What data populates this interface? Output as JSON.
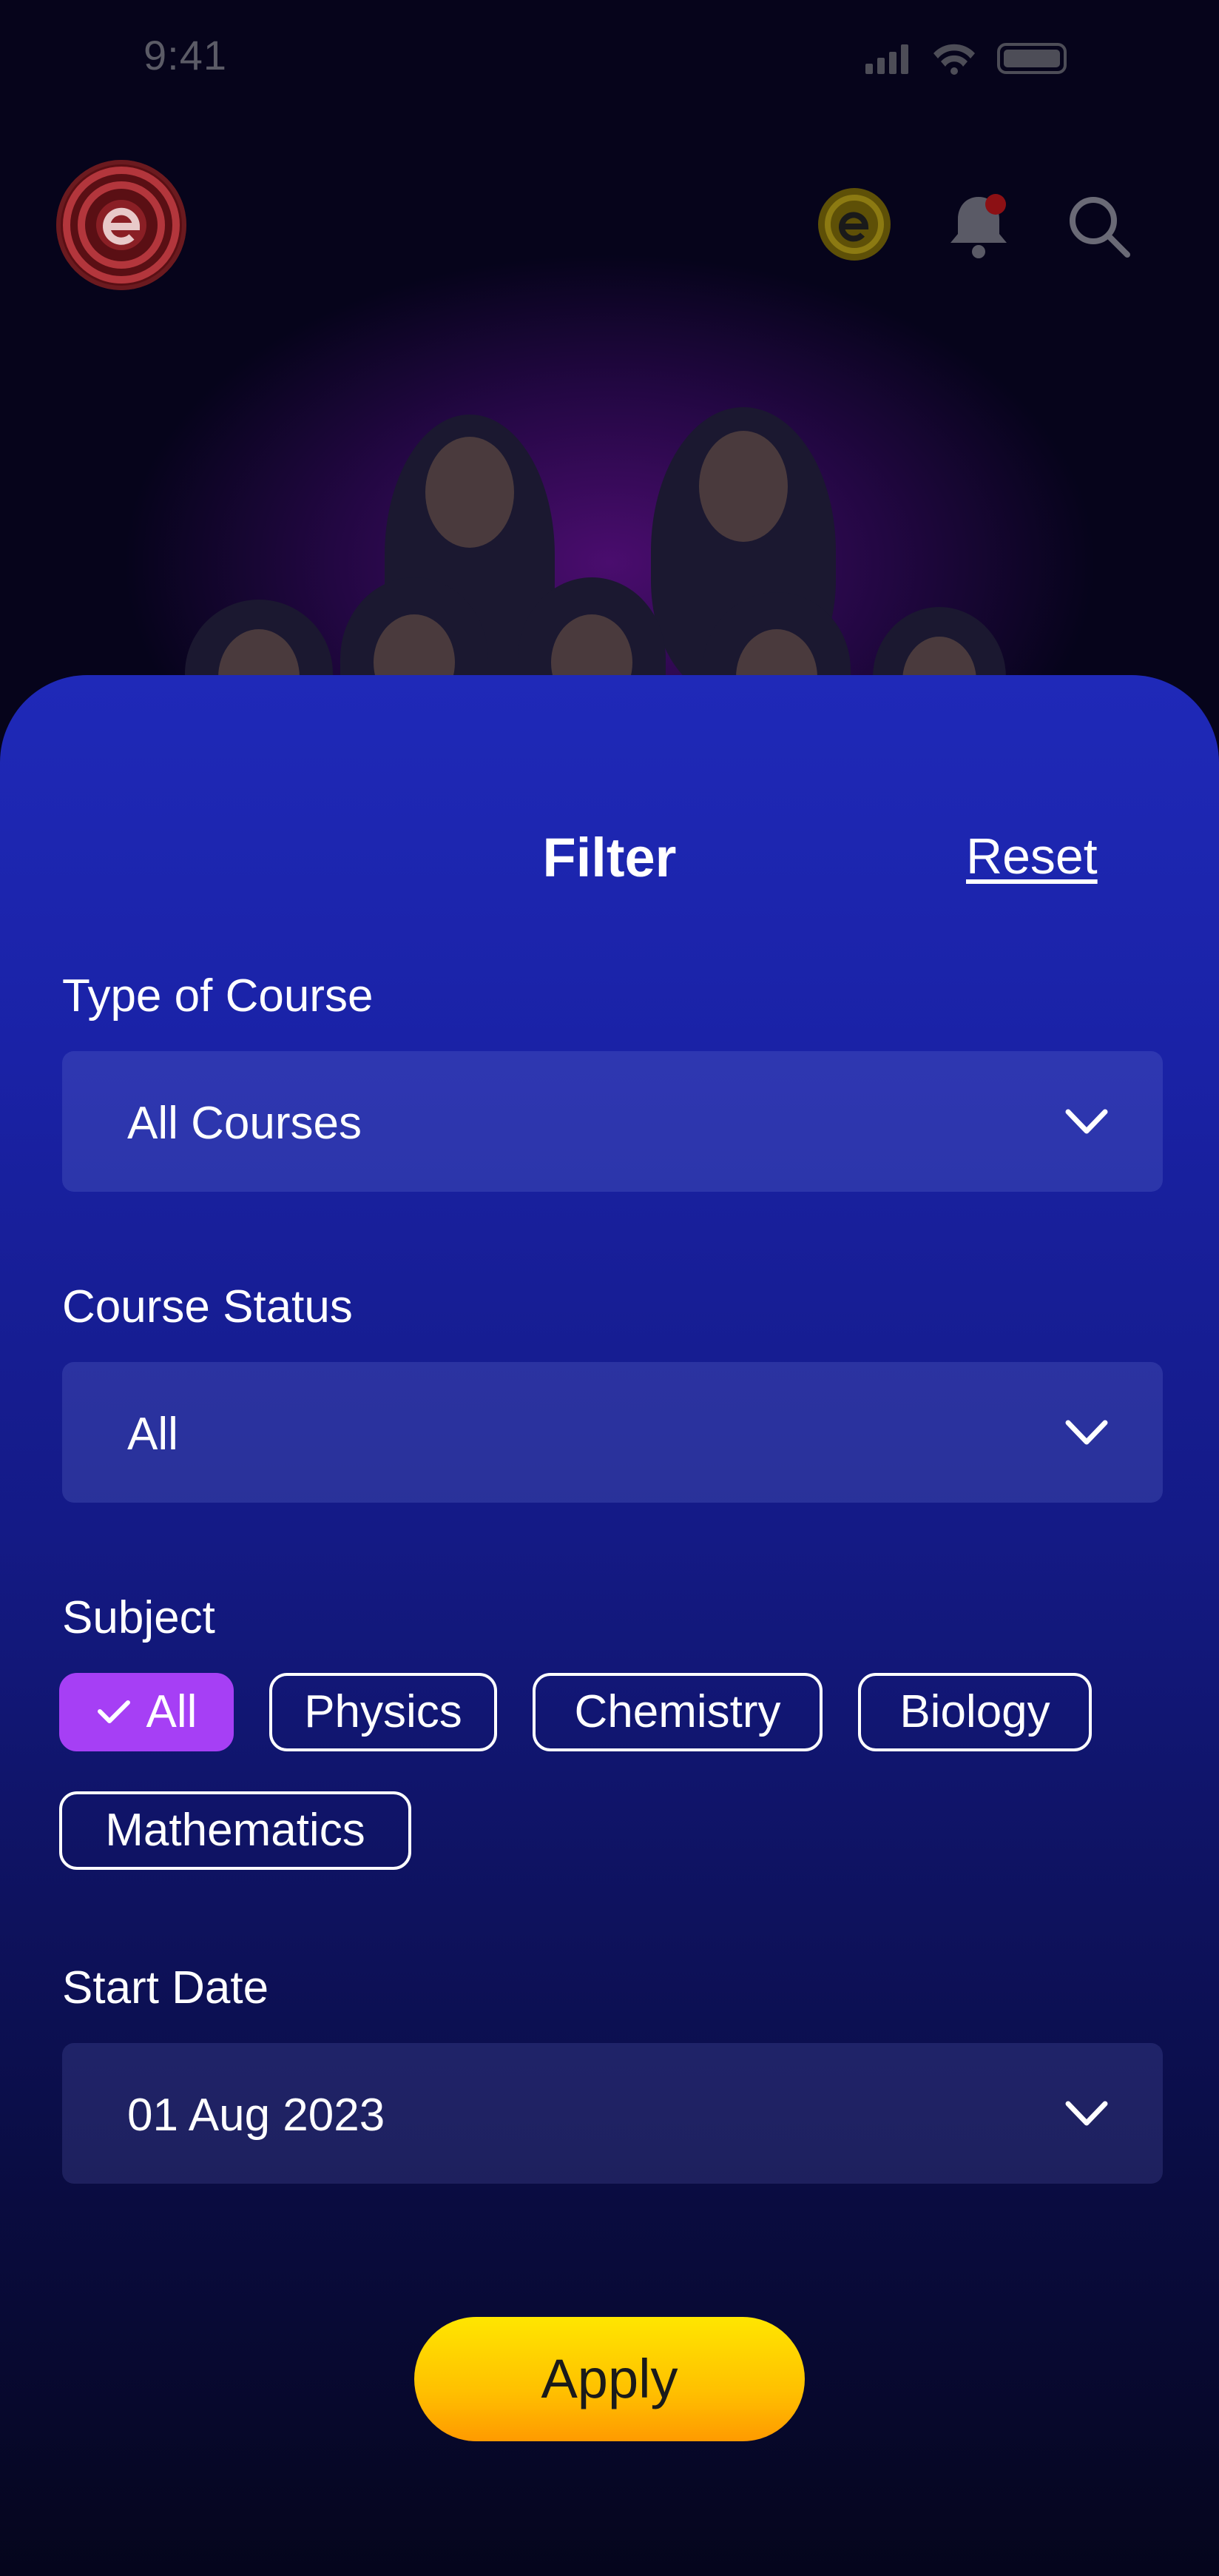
{
  "status_bar": {
    "time": "9:41"
  },
  "header": {
    "logo_icon": "brand-logo-icon",
    "coin_icon": "coin-icon",
    "bell_icon": "bell-icon",
    "search_icon": "search-icon"
  },
  "filter": {
    "title": "Filter",
    "reset_label": "Reset",
    "type_of_course": {
      "label": "Type of Course",
      "value": "All Courses"
    },
    "course_status": {
      "label": "Course Status",
      "value": "All"
    },
    "subject": {
      "label": "Subject",
      "chips": [
        {
          "label": "All",
          "selected": true
        },
        {
          "label": "Physics",
          "selected": false
        },
        {
          "label": "Chemistry",
          "selected": false
        },
        {
          "label": "Biology",
          "selected": false
        },
        {
          "label": "Mathematics",
          "selected": false
        }
      ]
    },
    "start_date": {
      "label": "Start Date",
      "value": "01 Aug 2023"
    },
    "apply_label": "Apply"
  },
  "colors": {
    "selected_chip": "#a63ff5",
    "apply_button": "#ffc000",
    "sheet": "#1a22a6"
  }
}
